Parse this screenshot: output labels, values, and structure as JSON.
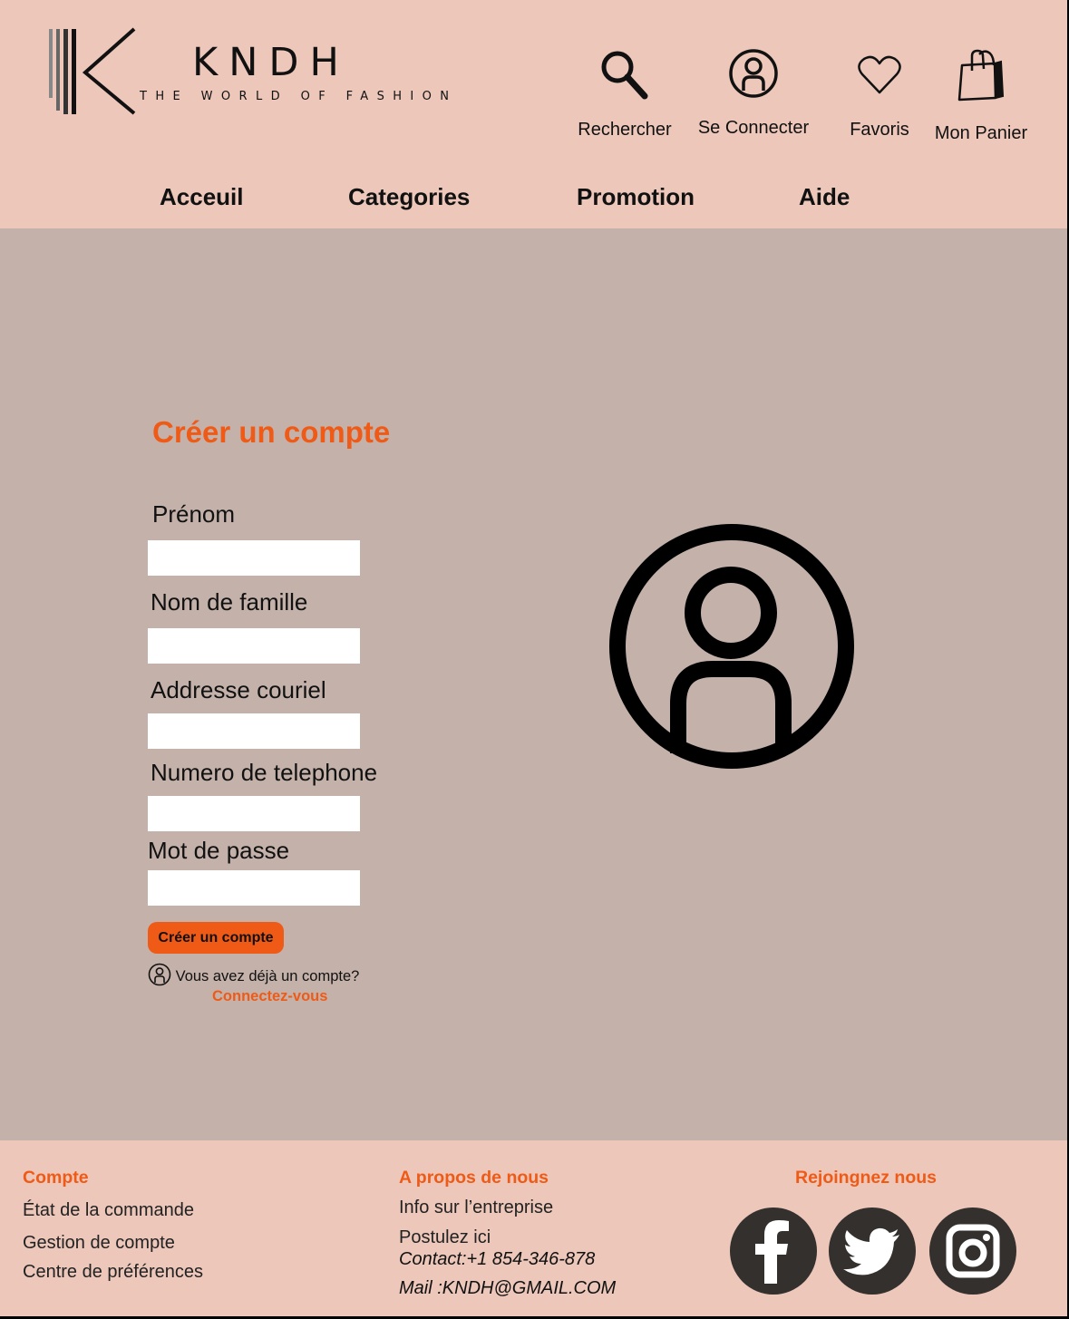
{
  "brand": {
    "name": "KNDH",
    "tagline": "THE WORLD OF FASHION"
  },
  "header_actions": [
    {
      "label": "Rechercher",
      "icon": "search-icon"
    },
    {
      "label": "Se Connecter",
      "icon": "user-circle-icon"
    },
    {
      "label": "Favoris",
      "icon": "heart-icon"
    },
    {
      "label": "Mon Panier",
      "icon": "shopping-bag-icon"
    }
  ],
  "nav": [
    "Acceuil",
    "Categories",
    "Promotion",
    "Aide"
  ],
  "form": {
    "title": "Créer un compte",
    "fields": [
      {
        "label": "Prénom",
        "value": ""
      },
      {
        "label": "Nom de famille",
        "value": ""
      },
      {
        "label": "Addresse couriel",
        "value": ""
      },
      {
        "label": "Numero de telephone",
        "value": ""
      },
      {
        "label": "Mot de passe",
        "value": ""
      }
    ],
    "submit_label": "Créer un compte",
    "have_account": "Vous avez déjà un compte?",
    "login_link": "Connectez-vous"
  },
  "footer": {
    "account": {
      "heading": "Compte",
      "links": [
        "État de la commande",
        "Gestion de compte",
        "Centre de préférences"
      ]
    },
    "about": {
      "heading": "A propos de nous",
      "links": [
        "Info sur l’entreprise",
        "Postulez ici"
      ],
      "contact": "Contact:+1 854-346-878",
      "mail": "Mail :KNDH@GMAIL.COM"
    },
    "social": {
      "heading": "Rejoingnez nous",
      "icons": [
        "facebook-icon",
        "twitter-icon",
        "instagram-icon"
      ]
    }
  },
  "colors": {
    "header_bg": "#ecc7ba",
    "main_bg": "#c4b2aa",
    "accent": "#ef5a16",
    "social_bg": "#34302e"
  }
}
